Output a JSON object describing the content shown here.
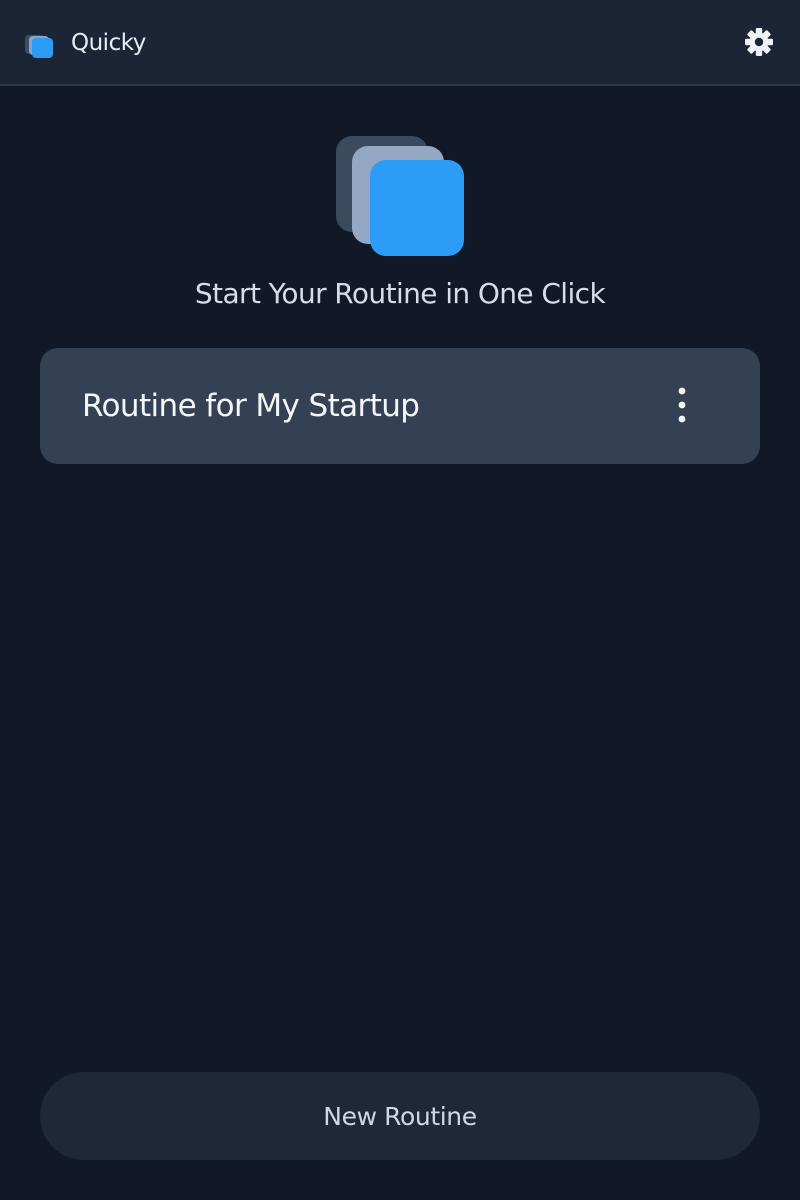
{
  "app": {
    "title": "Quicky"
  },
  "header": {
    "logo_icon": "stacked-cards-icon",
    "settings_icon": "gear-icon"
  },
  "hero": {
    "logo_icon": "stacked-cards-icon",
    "tagline": "Start Your Routine in One Click"
  },
  "routines": [
    {
      "name": "Routine for My Startup",
      "menu_icon": "more-vertical-icon"
    }
  ],
  "footer": {
    "new_routine_label": "New Routine"
  },
  "colors": {
    "background": "#111827",
    "header": "#1c2535",
    "card": "#344154",
    "button": "#1e2839",
    "accent": "#2d9cf6"
  }
}
